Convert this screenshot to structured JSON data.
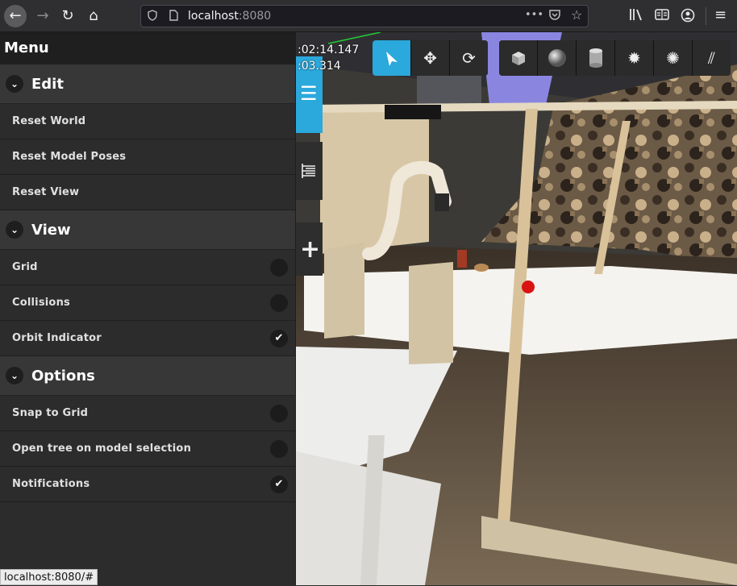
{
  "browser": {
    "url_host": "localhost",
    "url_port": ":8080",
    "back_icon": "←",
    "forward_icon": "→",
    "reload_icon": "↻",
    "home_icon": "⌂",
    "dots_icon": "•••",
    "menu_icon": "≡"
  },
  "menu": {
    "title": "Menu",
    "sections": [
      {
        "title": "Edit",
        "items": [
          {
            "label": "Reset World"
          },
          {
            "label": "Reset Model Poses"
          },
          {
            "label": "Reset View"
          }
        ]
      },
      {
        "title": "View",
        "items": [
          {
            "label": "Grid",
            "checked": false
          },
          {
            "label": "Collisions",
            "checked": false
          },
          {
            "label": "Orbit Indicator",
            "checked": true
          }
        ]
      },
      {
        "title": "Options",
        "items": [
          {
            "label": "Snap to Grid",
            "checked": false
          },
          {
            "label": "Open tree on model selection",
            "checked": false
          },
          {
            "label": "Notifications",
            "checked": true
          }
        ]
      }
    ],
    "chevron": "⌄",
    "check": "✔"
  },
  "status_tooltip": "localhost:8080/#",
  "time": {
    "line1": ":02:14.147",
    "line2": ":03.314"
  },
  "side_tabs": {
    "menu_icon": "☰",
    "tree_icon": "⋮",
    "insert_icon": "+"
  },
  "toolbar": {
    "select_icon": "⬉",
    "translate_icon": "✥",
    "rotate_icon": "⟳",
    "box_icon": "■",
    "sphere_icon": "●",
    "cylinder_icon": "▮",
    "sun_icon": "✹",
    "spot_icon": "✺",
    "directional_icon": "⫽",
    "accent_color": "#2ba8dc"
  }
}
